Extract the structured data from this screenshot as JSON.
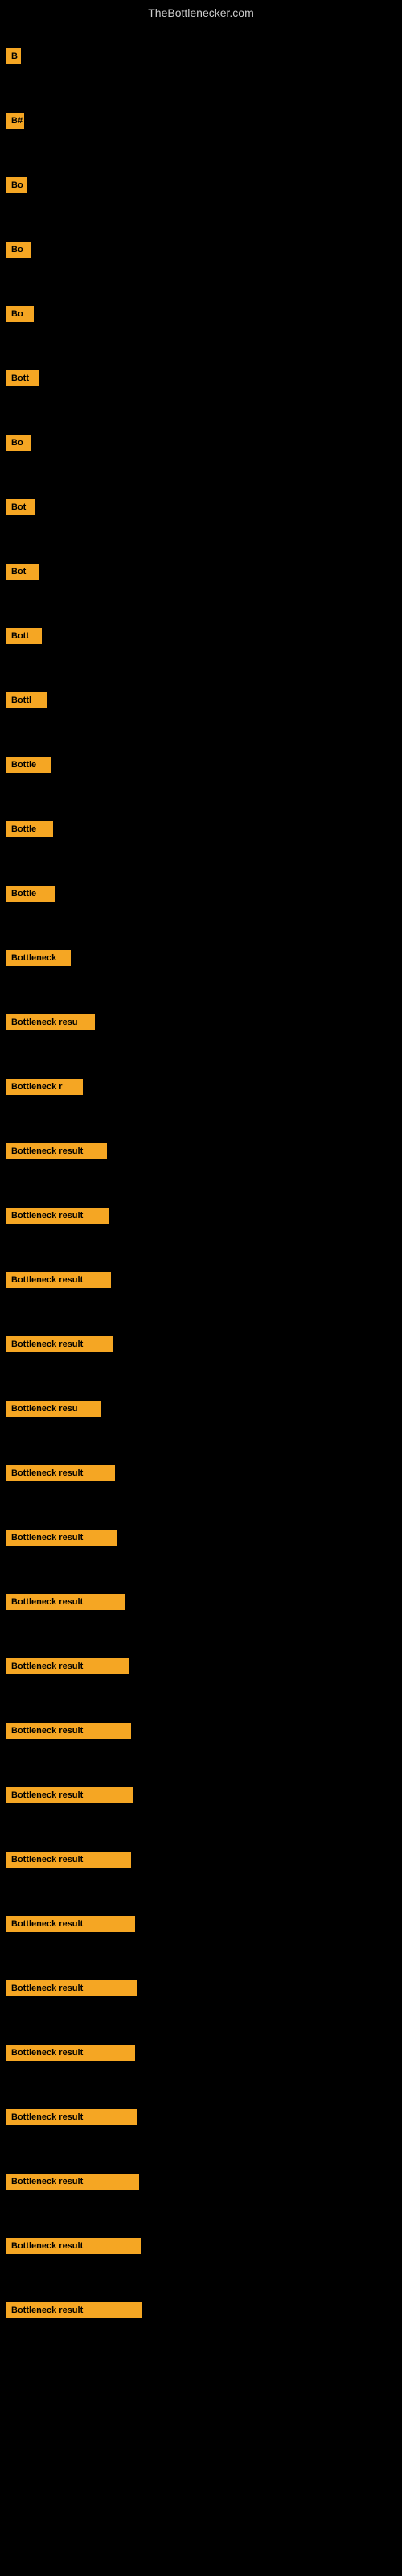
{
  "header": {
    "title": "TheBottlenecker.com"
  },
  "items": [
    {
      "id": 1,
      "label": "B",
      "width": 18
    },
    {
      "id": 2,
      "label": "B#",
      "width": 22
    },
    {
      "id": 3,
      "label": "Bo",
      "width": 26
    },
    {
      "id": 4,
      "label": "Bo",
      "width": 30
    },
    {
      "id": 5,
      "label": "Bo",
      "width": 34
    },
    {
      "id": 6,
      "label": "Bott",
      "width": 40
    },
    {
      "id": 7,
      "label": "Bo",
      "width": 30
    },
    {
      "id": 8,
      "label": "Bot",
      "width": 36
    },
    {
      "id": 9,
      "label": "Bot",
      "width": 40
    },
    {
      "id": 10,
      "label": "Bott",
      "width": 44
    },
    {
      "id": 11,
      "label": "Bottl",
      "width": 50
    },
    {
      "id": 12,
      "label": "Bottle",
      "width": 56
    },
    {
      "id": 13,
      "label": "Bottle",
      "width": 58
    },
    {
      "id": 14,
      "label": "Bottle",
      "width": 60
    },
    {
      "id": 15,
      "label": "Bottleneck",
      "width": 80
    },
    {
      "id": 16,
      "label": "Bottleneck resu",
      "width": 110
    },
    {
      "id": 17,
      "label": "Bottleneck r",
      "width": 95
    },
    {
      "id": 18,
      "label": "Bottleneck result",
      "width": 125
    },
    {
      "id": 19,
      "label": "Bottleneck result",
      "width": 128
    },
    {
      "id": 20,
      "label": "Bottleneck result",
      "width": 130
    },
    {
      "id": 21,
      "label": "Bottleneck result",
      "width": 132
    },
    {
      "id": 22,
      "label": "Bottleneck resu",
      "width": 118
    },
    {
      "id": 23,
      "label": "Bottleneck result",
      "width": 135
    },
    {
      "id": 24,
      "label": "Bottleneck result",
      "width": 138
    },
    {
      "id": 25,
      "label": "Bottleneck result",
      "width": 148
    },
    {
      "id": 26,
      "label": "Bottleneck result",
      "width": 152
    },
    {
      "id": 27,
      "label": "Bottleneck result",
      "width": 155
    },
    {
      "id": 28,
      "label": "Bottleneck result",
      "width": 158
    },
    {
      "id": 29,
      "label": "Bottleneck result",
      "width": 155
    },
    {
      "id": 30,
      "label": "Bottleneck result",
      "width": 160
    },
    {
      "id": 31,
      "label": "Bottleneck result",
      "width": 162
    },
    {
      "id": 32,
      "label": "Bottleneck result",
      "width": 160
    },
    {
      "id": 33,
      "label": "Bottleneck result",
      "width": 163
    },
    {
      "id": 34,
      "label": "Bottleneck result",
      "width": 165
    },
    {
      "id": 35,
      "label": "Bottleneck result",
      "width": 167
    },
    {
      "id": 36,
      "label": "Bottleneck result",
      "width": 168
    }
  ]
}
